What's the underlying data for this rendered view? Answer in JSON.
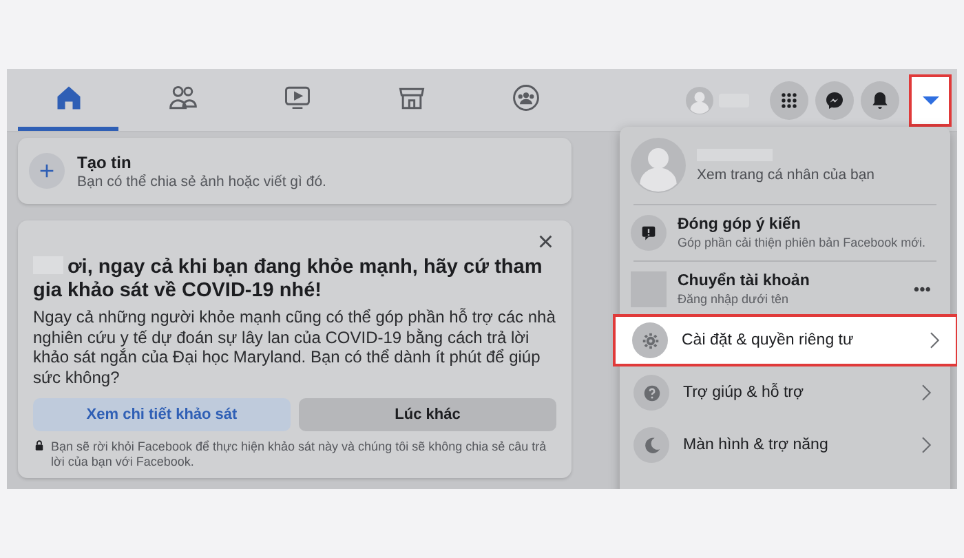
{
  "nav": {
    "tabs": [
      {
        "kind": "home",
        "selected": true
      },
      {
        "kind": "friends",
        "selected": false
      },
      {
        "kind": "video",
        "selected": false
      },
      {
        "kind": "store",
        "selected": false
      },
      {
        "kind": "groups",
        "selected": false
      }
    ],
    "actions": [
      {
        "kind": "grid",
        "highlighted": false
      },
      {
        "kind": "messenger",
        "highlighted": false
      },
      {
        "kind": "bell",
        "highlighted": false
      },
      {
        "kind": "caret",
        "highlighted": true
      }
    ]
  },
  "create_story": {
    "title": "Tạo tin",
    "subtitle": "Bạn có thể chia sẻ ảnh hoặc viết gì đó."
  },
  "survey": {
    "close": "×",
    "heading": "ơi, ngay cả khi bạn đang khỏe mạnh, hãy cứ tham gia khảo sát về COVID-19 nhé!",
    "body": "Ngay cả những người khỏe mạnh cũng có thể góp phần hỗ trợ các nhà nghiên cứu y tế dự đoán sự lây lan của COVID-19 bằng cách trả lời khảo sát ngắn của Đại học Maryland. Bạn có thể dành ít phút để giúp sức không?",
    "buttons": [
      {
        "label": "Xem chi tiết khảo sát",
        "kind": "primary"
      },
      {
        "label": "Lúc khác",
        "kind": "secondary"
      }
    ],
    "note": "Bạn sẽ rời khỏi Facebook để thực hiện khảo sát này và chúng tôi sẽ không chia sẻ câu trả lời của bạn với Facebook."
  },
  "menu": {
    "profile": {
      "subtitle": "Xem trang cá nhân của bạn"
    },
    "feedback": {
      "title": "Đóng góp ý kiến",
      "subtitle": "Góp phần cải thiện phiên bản Facebook mới."
    },
    "switch_account": {
      "title": "Chuyển tài khoản",
      "subtitle": "Đăng nhập dưới tên",
      "more": "•••"
    },
    "items": [
      {
        "label": "Cài đặt & quyền riêng tư",
        "kind": "gear",
        "highlighted": true
      },
      {
        "label": "Trợ giúp & hỗ trợ",
        "kind": "help",
        "highlighted": false
      },
      {
        "label": "Màn hình & trợ năng",
        "kind": "moon",
        "highlighted": false
      }
    ]
  }
}
